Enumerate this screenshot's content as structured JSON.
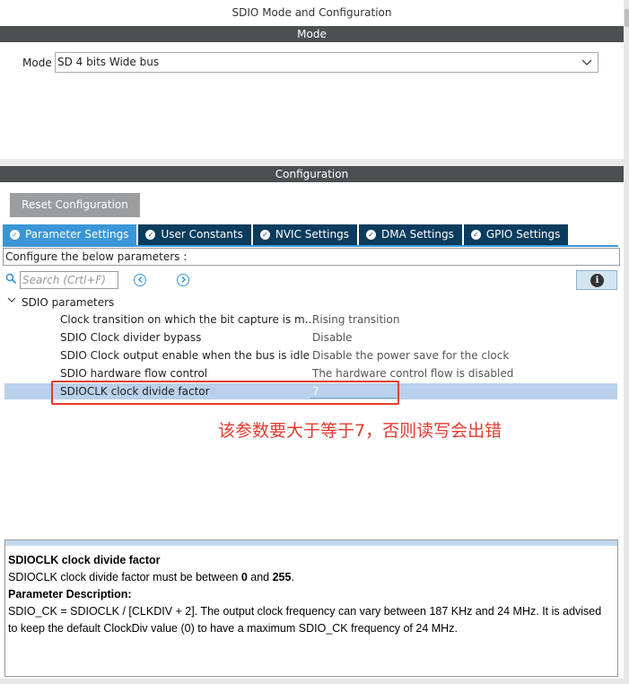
{
  "window": {
    "title": "SDIO Mode and Configuration"
  },
  "mode_section": {
    "header": "Mode",
    "label": "Mode",
    "selected": "SD 4 bits Wide bus"
  },
  "config_section": {
    "header": "Configuration",
    "reset_label": "Reset Configuration",
    "tabs": [
      {
        "label": "Parameter Settings",
        "active": true
      },
      {
        "label": "User Constants",
        "active": false
      },
      {
        "label": "NVIC Settings",
        "active": false
      },
      {
        "label": "DMA Settings",
        "active": false
      },
      {
        "label": "GPIO Settings",
        "active": false
      }
    ],
    "configure_text": "Configure the below parameters :",
    "search": {
      "placeholder": "Search (Crtl+F)"
    },
    "group": "SDIO parameters",
    "params": [
      {
        "name": "Clock transition on which the bit capture is m...",
        "value": "Rising transition"
      },
      {
        "name": "SDIO Clock divider bypass",
        "value": "Disable"
      },
      {
        "name": "SDIO Clock output enable when the bus is idle",
        "value": "Disable the power save for the clock"
      },
      {
        "name": "SDIO hardware flow control",
        "value": "The hardware control flow is disabled"
      },
      {
        "name": "SDIOCLK clock divide factor",
        "value": "7"
      }
    ]
  },
  "annotation": "该参数要大于等于7，否则读写会出错",
  "description": {
    "title": "SDIOCLK clock divide factor",
    "range_prefix": "SDIOCLK clock divide factor must be between ",
    "min": "0",
    "and_text": " and ",
    "max": "255",
    "range_suffix": ".",
    "param_desc_label": "Parameter Description:",
    "param_desc_text": "SDIO_CK = SDIOCLK / [CLKDIV + 2]. The output clock frequency can vary between 187 KHz and 24 MHz. It is advised to keep the default ClockDiv value (0) to have a maximum SDIO_CK frequency of 24 MHz."
  },
  "colors": {
    "band": "#4d4f51",
    "tab_active": "#3a96d6",
    "tab_inactive": "#0b3c5d",
    "annotation_red": "#e33b2e",
    "selected_row": "#b9d1ea"
  }
}
